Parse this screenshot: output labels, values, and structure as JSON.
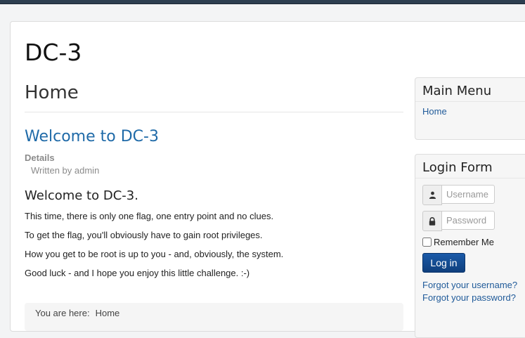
{
  "site": {
    "title": "DC-3"
  },
  "main": {
    "page_heading": "Home",
    "article": {
      "title": "Welcome to DC-3",
      "details_label": "Details",
      "written_by": "Written by admin",
      "heading": "Welcome to DC-3.",
      "paragraphs": [
        "This time, there is only one flag, one entry point and no clues.",
        "To get the flag, you'll obviously have to gain root privileges.",
        "How you get to be root is up to you - and, obviously, the system.",
        "Good luck - and I hope you enjoy this little challenge.  :-)"
      ]
    },
    "breadcrumb": {
      "prefix": "You are here:",
      "current": "Home"
    }
  },
  "sidebar": {
    "main_menu": {
      "title": "Main Menu",
      "items": [
        {
          "label": "Home"
        }
      ]
    },
    "login_form": {
      "title": "Login Form",
      "username_placeholder": "Username",
      "password_placeholder": "Password",
      "remember_label": "Remember Me",
      "login_button": "Log in",
      "forgot_username": "Forgot your username?",
      "forgot_password": "Forgot your password?"
    }
  },
  "icons": {
    "user": "user-icon",
    "lock": "lock-icon"
  },
  "colors": {
    "link": "#1f5a99",
    "button": "#15509a",
    "title_link": "#1f6aa8"
  }
}
